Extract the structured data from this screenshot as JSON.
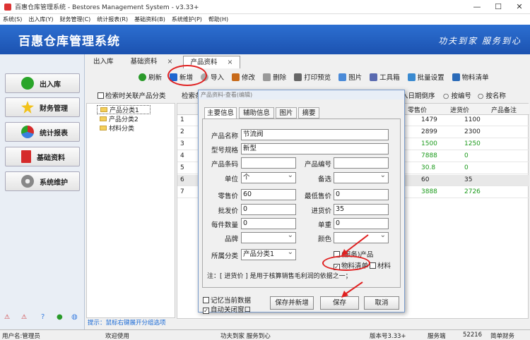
{
  "window": {
    "title": "百惠仓库管理系统 - Bestores Management System - v3.33+",
    "min": "—",
    "max": "☐",
    "close": "✕"
  },
  "menu": [
    "系统(S)",
    "出入库(Y)",
    "财务管理(C)",
    "统计报表(R)",
    "基础资料(B)",
    "系统维护(P)",
    "帮助(H)"
  ],
  "banner": {
    "title": "百惠仓库管理系统",
    "slogan": "功夫到家  服务到心"
  },
  "sidebar": [
    {
      "label": "出入库",
      "icon": "check-icon",
      "color": "#2aa52a"
    },
    {
      "label": "财务管理",
      "icon": "star-icon",
      "color": "#f2c21b"
    },
    {
      "label": "统计报表",
      "icon": "pie-chart-icon",
      "color": "#3a7ee0"
    },
    {
      "label": "基础资料",
      "icon": "book-icon",
      "color": "#d52a2a"
    },
    {
      "label": "系统维护",
      "icon": "gear-icon",
      "color": "#888888"
    }
  ],
  "tabs": [
    {
      "label": "出入库"
    },
    {
      "label": "基础资料"
    },
    {
      "label": "产品资料",
      "close": "×"
    }
  ],
  "tabclose": "×",
  "toolbar": [
    {
      "label": "刷新",
      "icon": "refresh-icon",
      "color": "#2a9a2a"
    },
    {
      "label": "新增",
      "icon": "add-icon",
      "color": "#1e66d0"
    },
    {
      "label": "导入",
      "icon": "import-icon",
      "color": "#888"
    },
    {
      "label": "修改",
      "icon": "edit-icon",
      "color": "#c86a1a"
    },
    {
      "label": "删除",
      "icon": "delete-icon",
      "color": "#999"
    },
    {
      "label": "打印预览",
      "icon": "print-icon",
      "color": "#666"
    },
    {
      "label": "图片",
      "icon": "image-icon",
      "color": "#4a8ad8"
    },
    {
      "label": "工具箱",
      "icon": "toolbox-icon",
      "color": "#5a6ab0"
    },
    {
      "label": "批量设置",
      "icon": "batch-icon",
      "color": "#3a8ad0"
    },
    {
      "label": "物料清单",
      "icon": "bom-icon",
      "color": "#2a6ab8"
    }
  ],
  "filter": {
    "search_related": "检索时关联产品分类",
    "search_prefix": "检索条",
    "date_desc": "入日期倒序",
    "by_code": "按编号",
    "by_name": "按名称"
  },
  "tree": [
    "产品分类1",
    "产品分类2",
    "材料分类"
  ],
  "hint": "提示：鼠标右键展开分组选项",
  "grid": {
    "columns": [
      "零售价",
      "进货价",
      "产品备注"
    ],
    "rows": [
      {
        "n": "1",
        "retail": "1479",
        "cost": "1100",
        "color": "#222"
      },
      {
        "n": "2",
        "retail": "2899",
        "cost": "2300",
        "color": "#222"
      },
      {
        "n": "3",
        "retail": "1500",
        "cost": "1250",
        "color": "#1a9a1a"
      },
      {
        "n": "4",
        "retail": "7888",
        "cost": "0",
        "color": "#1a9a1a"
      },
      {
        "n": "5",
        "retail": "30.8",
        "cost": "0",
        "color": "#1a9a1a"
      },
      {
        "n": "6",
        "retail": "60",
        "cost": "35",
        "color": "#222"
      },
      {
        "n": "7",
        "retail": "3888",
        "cost": "2726",
        "color": "#1a9a1a"
      }
    ]
  },
  "dialog": {
    "title": "产品资料-查看(编辑)",
    "tabs": [
      "主要信息",
      "辅助信息",
      "图片",
      "摘要"
    ],
    "fields": {
      "name_label": "产品名称",
      "name": "节流阀",
      "model_label": "型号规格",
      "model": "新型",
      "barcode_label": "产品条码",
      "barcode": "",
      "code_label": "产品编号",
      "code": "",
      "unit_label": "单位",
      "unit": "个",
      "memo_label": "备选",
      "memo": "",
      "retail_label": "零售价",
      "retail": "60",
      "minprice_label": "最低售价",
      "minprice": "0",
      "wholesale_label": "批发价",
      "wholesale": "0",
      "cost_label": "进货价",
      "cost": "35",
      "qtyper_label": "每件数量",
      "qtyper": "0",
      "weight_label": "单重",
      "weight": "0",
      "brand_label": "品牌",
      "brand": "",
      "color_label": "颜色",
      "color": "",
      "category_label": "所属分类",
      "category": "产品分类1"
    },
    "service_label": "(服务)产品",
    "bom_label": "物料清单",
    "material_label": "材料",
    "note": "注：[ 进货价 ] 是用于核算销售毛利润的依据之一；",
    "remember": "记忆当前数据",
    "autoclose": "自动关闭窗口",
    "save_new": "保存并新增",
    "save": "保存",
    "cancel": "取消"
  },
  "status": {
    "user": "用户名:管理员",
    "welcome": "欢迎使用",
    "slogan": "功夫到家 服务到心",
    "version": "版本号3.33+",
    "service": "服务端",
    "port": "52216",
    "mode": "简单财务"
  }
}
